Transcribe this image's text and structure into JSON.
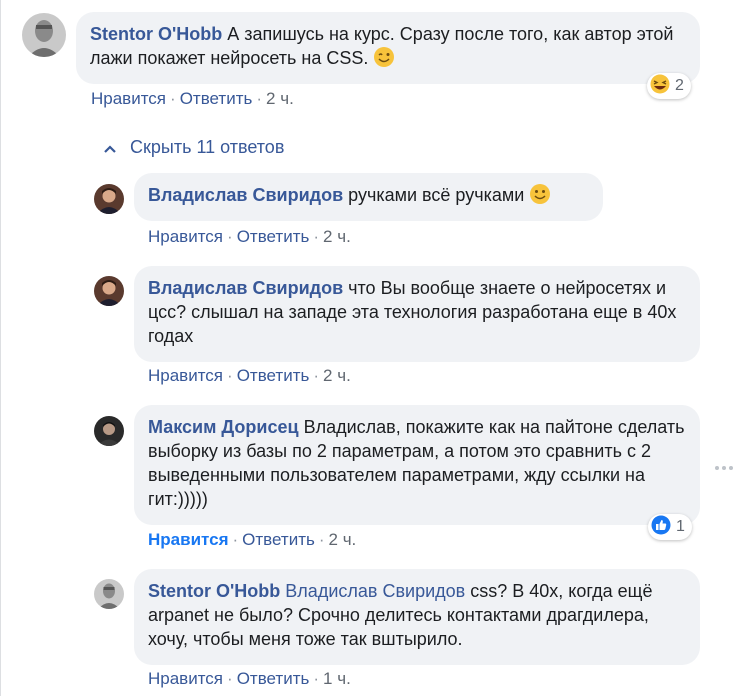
{
  "top_comment": {
    "author": "Stentor O'Hobb",
    "text": " А запишусь на курс. Сразу после того, как автор этой лажи покажет нейросеть на CSS.",
    "actions": {
      "like": "Нравится",
      "reply": "Ответить",
      "time": "2 ч."
    },
    "reaction": {
      "icon": "laughing-emoji-icon",
      "count": "2"
    }
  },
  "hide_replies": "Скрыть 11 ответов",
  "replies": [
    {
      "author": "Владислав Свиридов",
      "text": " ручками всё ручками",
      "actions": {
        "like": "Нравится",
        "reply": "Ответить",
        "time": "2 ч."
      }
    },
    {
      "author": "Владислав Свиридов",
      "text": " что Вы вообще знаете о нейросетях и цсс? слышал на западе эта технология разработана еще в 40х годах",
      "actions": {
        "like": "Нравится",
        "reply": "Ответить",
        "time": "2 ч."
      }
    },
    {
      "author": "Максим Дорисец",
      "text": " Владислав, покажите как на пайтоне сделать выборку из базы по 2 параметрам, а потом это сравнить с 2 выведенными пользователем параметрами, жду ссылки на гит:)))))",
      "actions": {
        "like": "Нравится",
        "reply": "Ответить",
        "time": "2 ч."
      },
      "reaction": {
        "icon": "like-thumb-icon",
        "count": "1"
      }
    },
    {
      "author": "Stentor O'Hobb",
      "mention": "Владислав Свиридов",
      "text": " css? В 40х, когда ещё arpanet не было? Срочно делитесь контактами драгдилера, хочу, чтобы меня тоже так вштырило.",
      "actions": {
        "like": "Нравится",
        "reply": "Ответить",
        "time": "1 ч."
      }
    }
  ],
  "colors": {
    "link": "#385898",
    "bubble": "#f0f2f5",
    "like_active": "#1877f2"
  }
}
